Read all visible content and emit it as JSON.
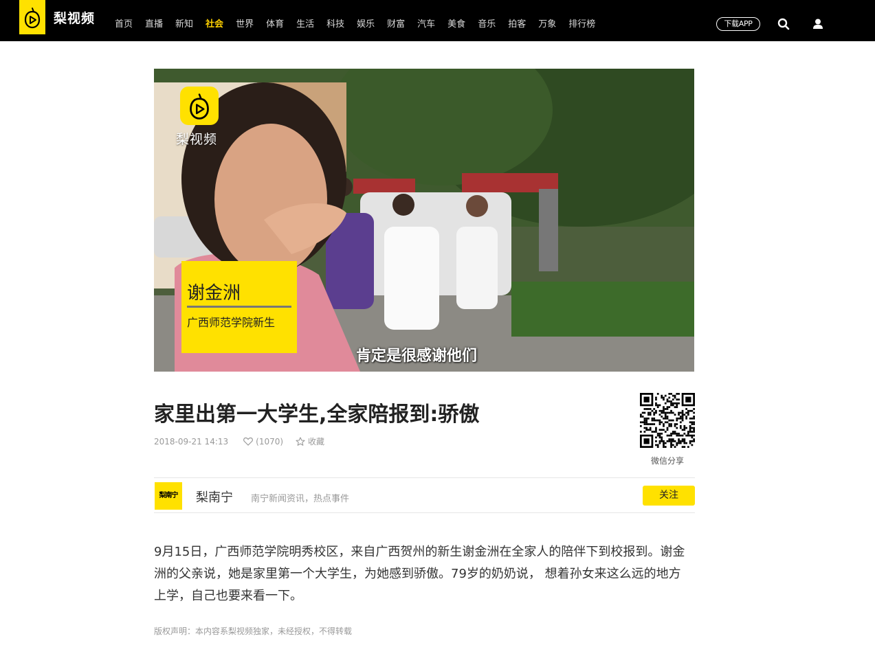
{
  "header": {
    "logo_text": "梨视频",
    "nav": [
      "首页",
      "直播",
      "新知",
      "社会",
      "世界",
      "体育",
      "生活",
      "科技",
      "娱乐",
      "财富",
      "汽车",
      "美食",
      "音乐",
      "拍客",
      "万象",
      "排行榜"
    ],
    "active_index": 3,
    "download_label": "下载APP"
  },
  "video": {
    "watermark_text": "梨视频",
    "name_card": {
      "name": "谢金洲",
      "subtitle": "广西师范学院新生"
    },
    "caption": "肯定是很感谢他们"
  },
  "article": {
    "title": "家里出第一大学生,全家陪报到:骄傲",
    "date": "2018-09-21 14:13",
    "likes": "(1070)",
    "favorite_label": "收藏",
    "qr_label": "微信分享"
  },
  "author": {
    "avatar_text": "梨南宁",
    "name": "梨南宁",
    "description": "南宁新闻资讯，热点事件",
    "follow_label": "关注"
  },
  "summary": "9月15日，广西师范学院明秀校区，来自广西贺州的新生谢金洲在全家人的陪伴下到校报到。谢金洲的父亲说，她是家里第一个大学生，为她感到骄傲。79岁的奶奶说， 想着孙女来这么远的地方上学，自己也要来看一下。",
  "copyright": "版权声明：本内容系梨视频独家，未经授权，不得转载",
  "colors": {
    "brand_yellow": "#ffe100",
    "nav_active": "#ffd100",
    "topbar": "#000000"
  }
}
